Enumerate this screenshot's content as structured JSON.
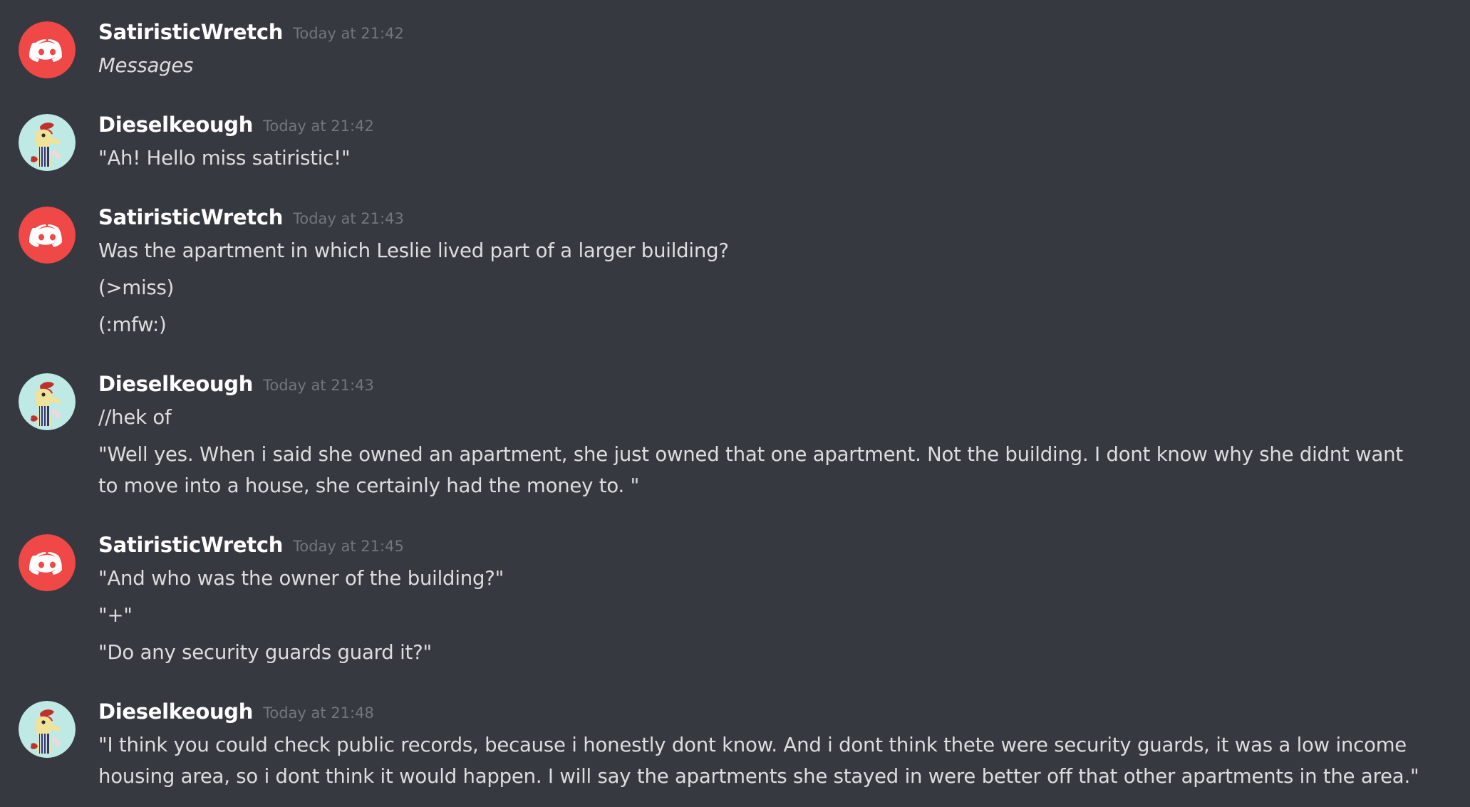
{
  "colors": {
    "background": "#36393f",
    "username": "#ffffff",
    "timestamp": "#72767d",
    "text": "#dcddde",
    "discord_avatar": "#f04747"
  },
  "messages": [
    {
      "author": "SatiristicWretch",
      "avatar": "discord-logo-icon",
      "timestamp": "Today at 21:42",
      "lines": [
        "Messages"
      ]
    },
    {
      "author": "Dieselkeough",
      "avatar": "pony-avatar",
      "timestamp": "Today at 21:42",
      "lines": [
        "\"Ah! Hello miss satiristic!\""
      ]
    },
    {
      "author": "SatiristicWretch",
      "avatar": "discord-logo-icon",
      "timestamp": "Today at 21:43",
      "lines": [
        "Was the apartment in which Leslie lived part of a larger building?",
        "(>miss)",
        "(:mfw:)"
      ]
    },
    {
      "author": "Dieselkeough",
      "avatar": "pony-avatar",
      "timestamp": "Today at 21:43",
      "lines": [
        "//hek of",
        "\"Well yes. When i said she owned an apartment, she just owned that one apartment. Not the building. I dont know why she didnt want to move into a house, she certainly had the money to. \""
      ]
    },
    {
      "author": "SatiristicWretch",
      "avatar": "discord-logo-icon",
      "timestamp": "Today at 21:45",
      "lines": [
        "\"And who was the owner of the building?\"",
        "\"+\"",
        "\"Do any security guards guard it?\""
      ]
    },
    {
      "author": "Dieselkeough",
      "avatar": "pony-avatar",
      "timestamp": "Today at 21:48",
      "lines": [
        "\"I think you could check public records, because i honestly dont know. And i dont think thete were security guards, it was a low income housing area, so i dont think it would happen. I will say the apartments she stayed in were better off that other apartments in the area.\""
      ]
    }
  ]
}
